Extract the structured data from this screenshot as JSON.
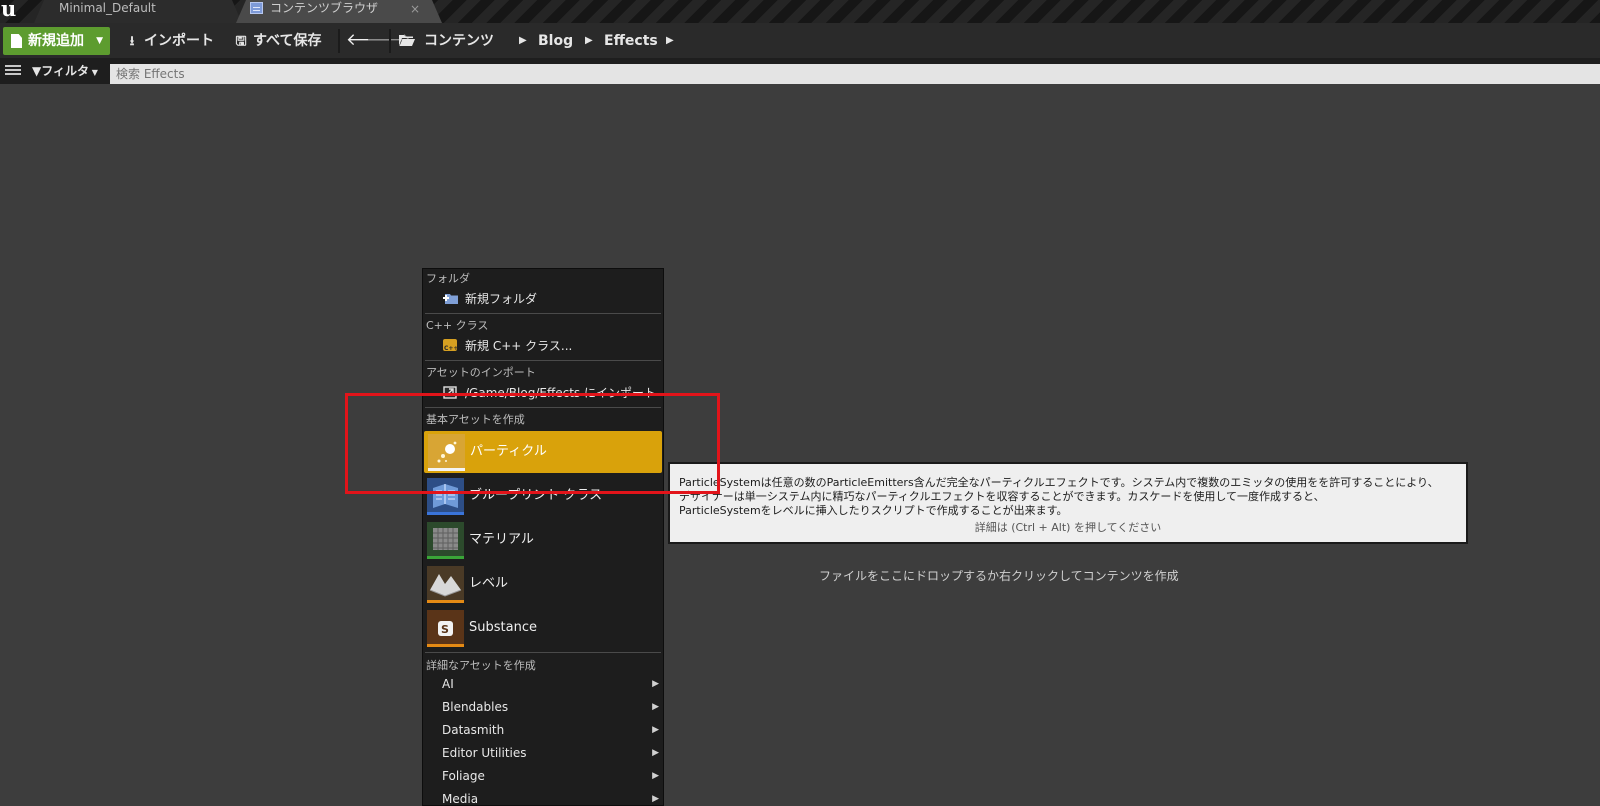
{
  "tabs": {
    "level_tab": "Minimal_Default",
    "content_tab": "コンテンツブラウザ",
    "close_glyph": "×"
  },
  "toolbar": {
    "add_new_label": "新規追加",
    "import_label": "インポート",
    "save_all_label": "すべて保存",
    "accent_color": "#5d9c2f"
  },
  "breadcrumb": {
    "items": [
      "コンテンツ",
      "Blog",
      "Effects"
    ]
  },
  "filterbar": {
    "filter_label": "フィルタ",
    "search_placeholder": "検索 Effects"
  },
  "empty_hint": "ファイルをここにドロップするか右クリックしてコンテンツを作成",
  "context_menu": {
    "sections": {
      "folder": "フォルダ",
      "cpp": "C++ クラス",
      "import": "アセットのインポート",
      "basic": "基本アセットを作成",
      "advanced": "詳細なアセットを作成"
    },
    "new_folder": "新規フォルダ",
    "new_cpp_class": "新規 C++ クラス...",
    "import_to": "/Game/Blog/Effects にインポート",
    "basic_assets": [
      {
        "label": "パーティクル",
        "icon": "particle-icon",
        "color": "#f4f4f4",
        "selected": true
      },
      {
        "label": "ブループリント クラス",
        "icon": "blueprint-icon",
        "color": "#3a74d9"
      },
      {
        "label": "マテリアル",
        "icon": "material-icon",
        "color": "#3aa538"
      },
      {
        "label": "レベル",
        "icon": "level-icon",
        "color": "#e48a14"
      },
      {
        "label": "Substance",
        "icon": "substance-icon",
        "color": "#e48a14"
      }
    ],
    "advanced_assets": [
      "AI",
      "Blendables",
      "Datasmith",
      "Editor Utilities",
      "Foliage",
      "Media"
    ],
    "highlight_color": "#d9a20b"
  },
  "tooltip": {
    "lines": [
      "ParticleSystemは任意の数のParticleEmitters含んだ完全なパーティクルエフェクトです。システム内で複数のエミッタの使用をを許可することにより、",
      "デザイナーは単一システム内に精巧なパーティクルエフェクトを収容することができます。カスケードを使用して一度作成すると、",
      "ParticleSystemをレベルに挿入したりスクリプトで作成することが出来ます。"
    ],
    "hint": "詳細は (Ctrl + Alt) を押してください"
  },
  "annotation_color": "#e2141a"
}
